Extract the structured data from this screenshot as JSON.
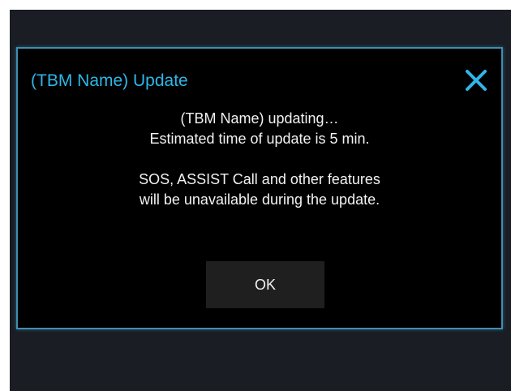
{
  "dialog": {
    "title": "(TBM Name) Update",
    "close_icon": "close-icon",
    "message_lines": [
      "(TBM Name) updating…",
      "Estimated time of update is 5 min.",
      "SOS, ASSIST Call and other features",
      "will be unavailable during the update."
    ],
    "ok_label": "OK"
  },
  "colors": {
    "title": "#2fb6e8",
    "close_icon": "#2fb6e8",
    "border": "#3e8fb3",
    "dialog_bg": "#000000",
    "screen_bg": "#1a1d24",
    "button_bg": "#1f1f1f",
    "text": "#f2f2f2"
  }
}
